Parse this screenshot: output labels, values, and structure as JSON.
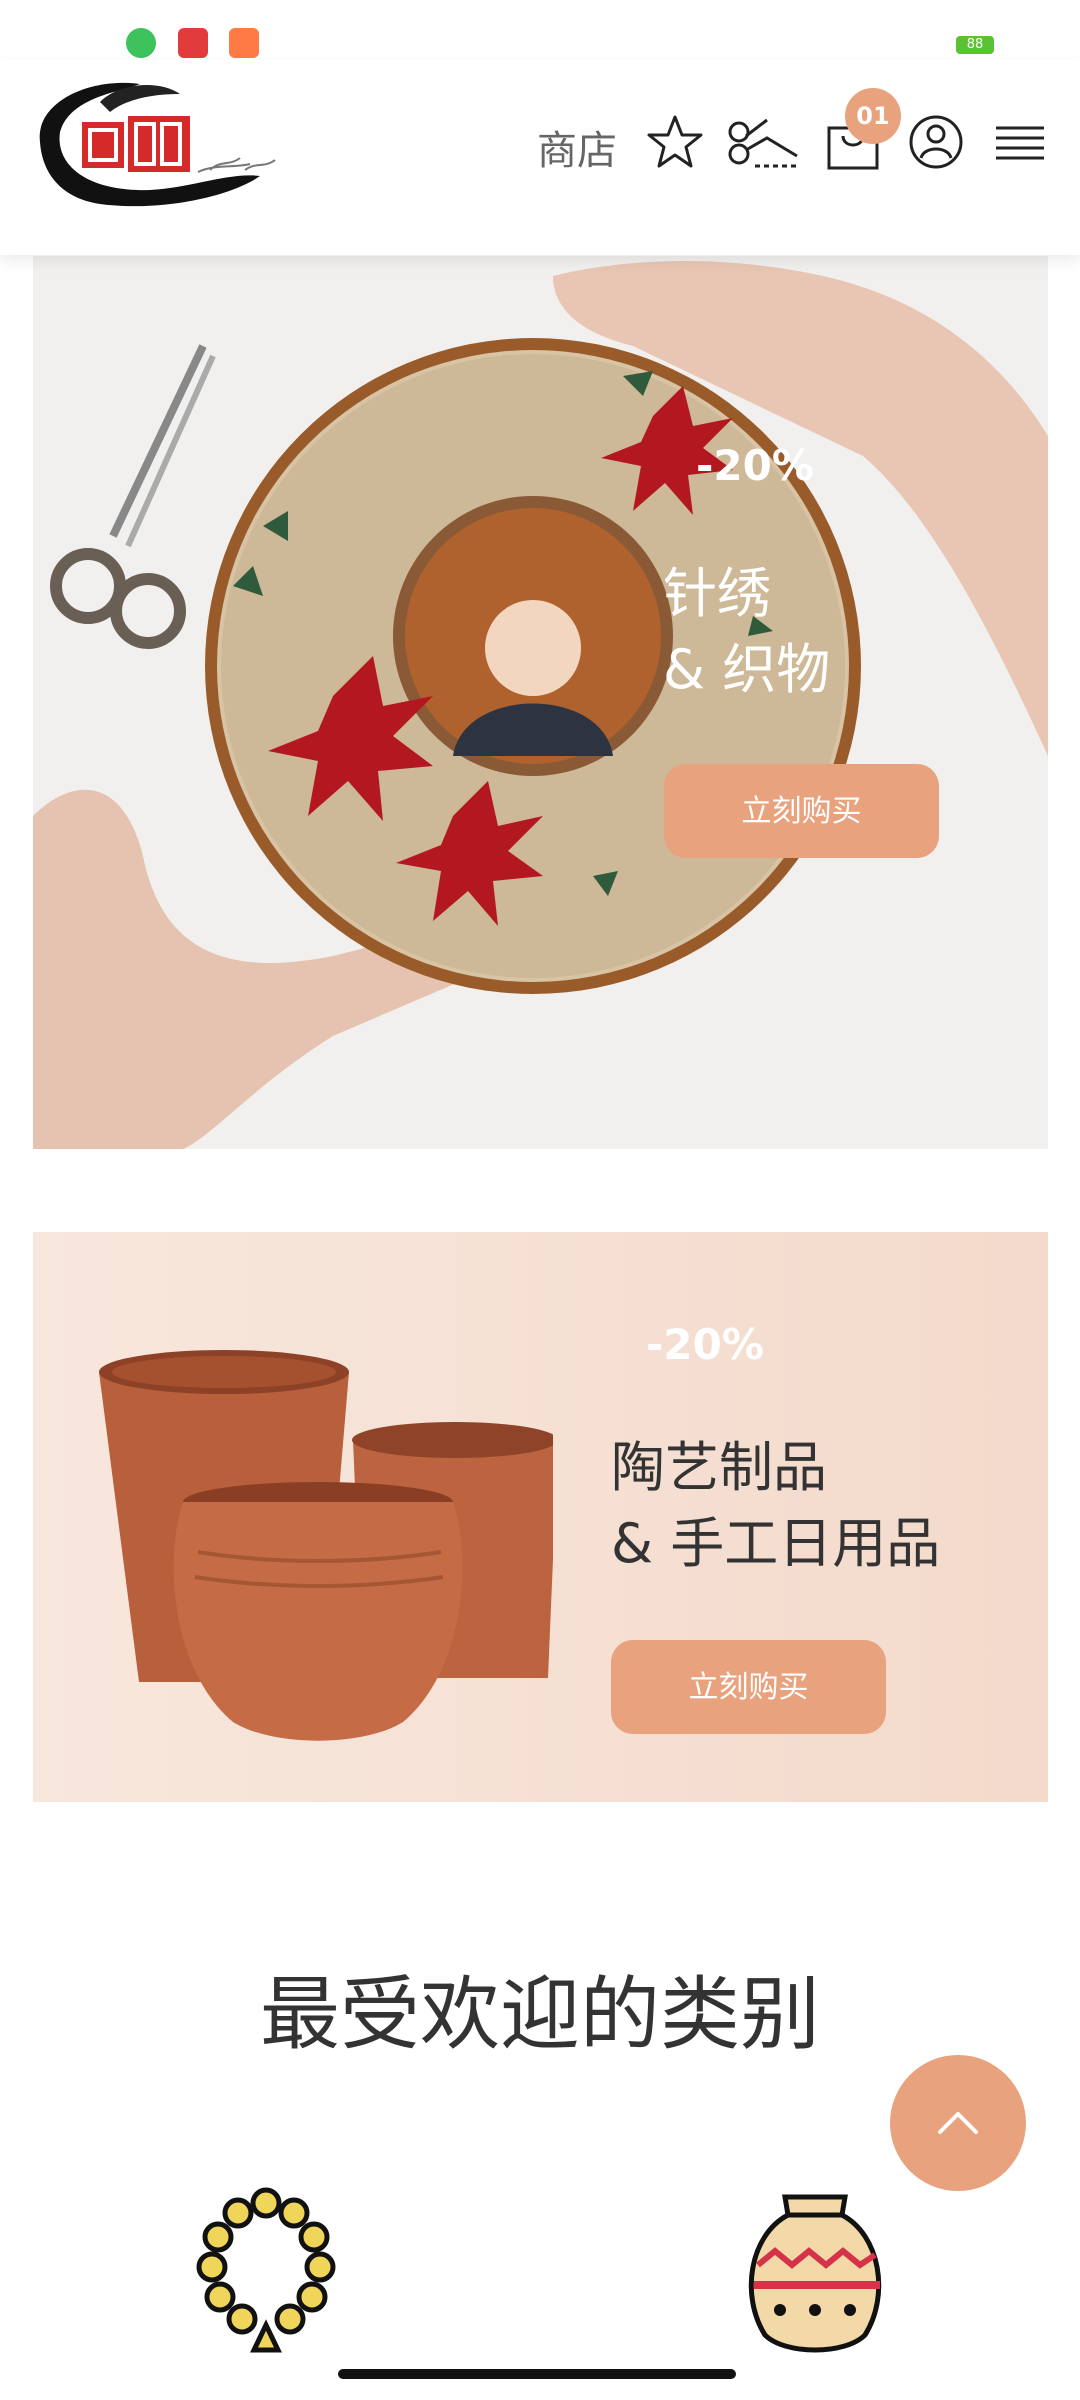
{
  "header": {
    "nav_shop": "商店",
    "cart_count": "01"
  },
  "banners": [
    {
      "discount": "-20%",
      "title_line1": "针绣",
      "title_line2": "& 织物",
      "button": "立刻购买"
    },
    {
      "discount": "-20%",
      "title_line1": "陶艺制品",
      "title_line2": "& 手工日用品",
      "button": "立刻购买"
    }
  ],
  "section": {
    "title": "最受欢迎的类别"
  },
  "status_bar": {
    "battery": "88"
  },
  "colors": {
    "accent": "#e9a27e",
    "text_dark": "#333333",
    "nav_text": "#666666"
  }
}
